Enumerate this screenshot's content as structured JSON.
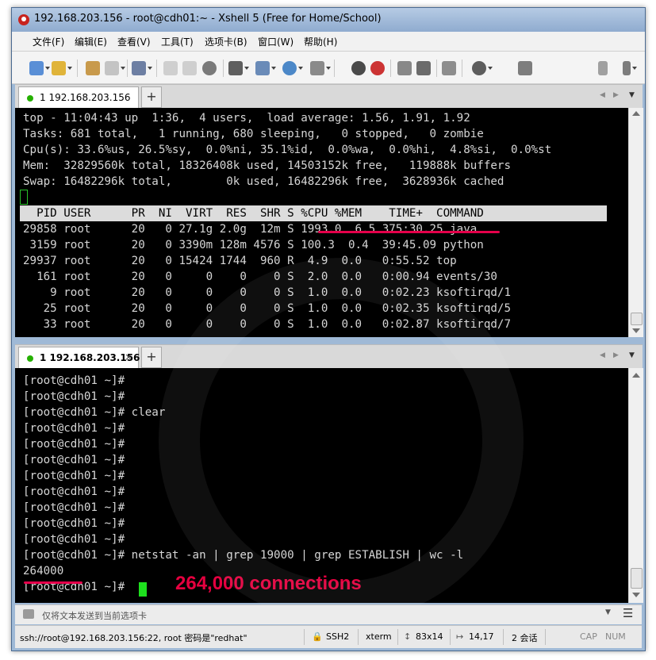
{
  "window": {
    "title": "192.168.203.156 - root@cdh01:~ - Xshell 5 (Free for Home/School)"
  },
  "menu": [
    "文件(F)",
    "编辑(E)",
    "查看(V)",
    "工具(T)",
    "选项卡(B)",
    "窗口(W)",
    "帮助(H)"
  ],
  "tabs": {
    "top_label": "1 192.168.203.156",
    "bottom_label": "1 192.168.203.156",
    "add": "+",
    "close": "×"
  },
  "top_pane": {
    "summary_lines": [
      "top - 11:04:43 up  1:36,  4 users,  load average: 1.56, 1.91, 1.92",
      "Tasks: 681 total,   1 running, 680 sleeping,   0 stopped,   0 zombie",
      "Cpu(s): 33.6%us, 26.5%sy,  0.0%ni, 35.1%id,  0.0%wa,  0.0%hi,  4.8%si,  0.0%st",
      "Mem:  32829560k total, 18326408k used, 14503152k free,   119888k buffers",
      "Swap: 16482296k total,        0k used, 16482296k free,  3628936k cached"
    ],
    "header": "  PID USER      PR  NI  VIRT  RES  SHR S %CPU %MEM    TIME+  COMMAND       ",
    "process_rows": [
      "29858 root      20   0 27.1g 2.0g  12m S 1993.0  6.5 375:30.25 java",
      " 3159 root      20   0 3390m 128m 4576 S 100.3  0.4  39:45.09 python",
      "29937 root      20   0 15424 1744  960 R  4.9  0.0   0:55.52 top",
      "  161 root      20   0     0    0    0 S  2.0  0.0   0:00.94 events/30",
      "    9 root      20   0     0    0    0 S  1.0  0.0   0:02.23 ksoftirqd/1",
      "   25 root      20   0     0    0    0 S  1.0  0.0   0:02.35 ksoftirqd/5",
      "   33 root      20   0     0    0    0 S  1.0  0.0   0:02.87 ksoftirqd/7"
    ]
  },
  "bottom_pane": {
    "lines": [
      "[root@cdh01 ~]#",
      "[root@cdh01 ~]#",
      "[root@cdh01 ~]# clear",
      "[root@cdh01 ~]#",
      "[root@cdh01 ~]#",
      "[root@cdh01 ~]#",
      "[root@cdh01 ~]#",
      "[root@cdh01 ~]#",
      "[root@cdh01 ~]#",
      "[root@cdh01 ~]#",
      "[root@cdh01 ~]#",
      "[root@cdh01 ~]# netstat -an | grep 19000 | grep ESTABLISH | wc -l",
      "264000",
      "[root@cdh01 ~]# "
    ],
    "annotation": "264,000 connections"
  },
  "compose": {
    "placeholder": "仅将文本发送到当前选项卡"
  },
  "status": {
    "connection": "ssh://root@192.168.203.156:22, root 密码是\"redhat\"",
    "protocol": "SSH2",
    "term": "xterm",
    "size": "83x14",
    "cursor": "14,17",
    "sessions": "2 会话",
    "caps": "CAP",
    "num": "NUM"
  },
  "colors": {
    "accent_red": "#e5003f",
    "cursor_green": "#1ee01e",
    "tab_dot": "#25b000"
  }
}
